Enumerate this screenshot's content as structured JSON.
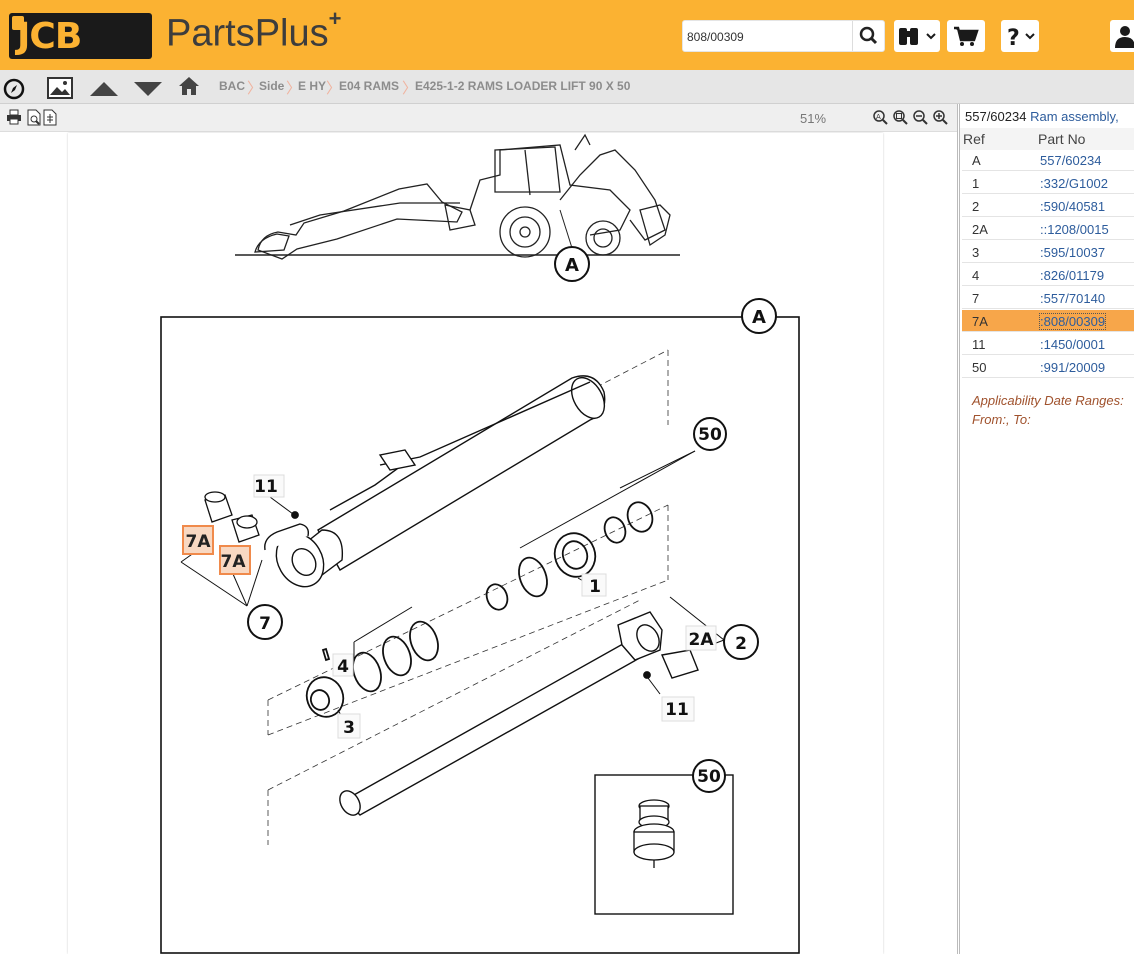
{
  "header": {
    "logo_text": "JCB",
    "brand": "PartsPlus",
    "brand_plus": "+",
    "search_value": "808/00309"
  },
  "breadcrumb": [
    "BAC",
    "Side",
    "E HY",
    "E04 RAMS",
    "E425-1-2 RAMS LOADER LIFT 90 X 50"
  ],
  "zoom_level": "51%",
  "diagram": {
    "callouts": [
      "A",
      "A",
      "50",
      "11",
      "7A",
      "7A",
      "1",
      "7",
      "2",
      "2A",
      "4",
      "11",
      "3",
      "50"
    ]
  },
  "parts_panel": {
    "title_part": "557/60234",
    "title_desc": "Ram assembly,",
    "col_ref": "Ref",
    "col_part": "Part No",
    "rows": [
      {
        "ref": "A",
        "part": "557/60234",
        "selected": false
      },
      {
        "ref": "1",
        "part": ":332/G1002",
        "selected": false
      },
      {
        "ref": "2",
        "part": ":590/40581",
        "selected": false
      },
      {
        "ref": "2A",
        "part": "::1208/0015",
        "selected": false
      },
      {
        "ref": "3",
        "part": ":595/10037",
        "selected": false
      },
      {
        "ref": "4",
        "part": ":826/01179",
        "selected": false
      },
      {
        "ref": "7",
        "part": ":557/70140",
        "selected": false
      },
      {
        "ref": "7A",
        "part": ":808/00309",
        "selected": true
      },
      {
        "ref": "11",
        "part": ":1450/0001",
        "selected": false
      },
      {
        "ref": "50",
        "part": ":991/20009",
        "selected": false
      }
    ],
    "applicability_label": "Applicability Date Ranges:",
    "applicability_value": "From:, To:"
  },
  "colors": {
    "brand_orange": "#fbb232",
    "selected_row": "#f7a64a",
    "link_blue": "#2d5c9c",
    "highlight": "#f08a4b"
  },
  "icons": [
    "search-icon",
    "binoculars-icon",
    "cart-icon",
    "help-icon",
    "user-icon",
    "compass-icon",
    "image-icon",
    "arrow-up-icon",
    "arrow-down-icon",
    "home-icon",
    "print-icon",
    "print-preview-icon",
    "export-icon",
    "zoom-in-icon",
    "zoom-fit-icon",
    "zoom-out-icon",
    "zoom-plus-icon"
  ]
}
